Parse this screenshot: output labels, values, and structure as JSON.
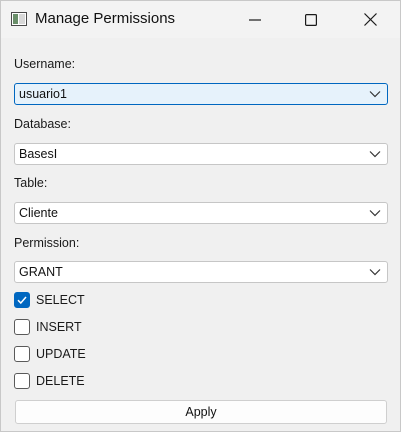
{
  "window": {
    "title": "Manage Permissions"
  },
  "form": {
    "username": {
      "label": "Username:",
      "value": "usuario1"
    },
    "database": {
      "label": "Database:",
      "value": "BasesI"
    },
    "table": {
      "label": "Table:",
      "value": "Cliente"
    },
    "permission": {
      "label": "Permission:",
      "value": "GRANT"
    }
  },
  "privileges": [
    {
      "label": "SELECT",
      "checked": true
    },
    {
      "label": "INSERT",
      "checked": false
    },
    {
      "label": "UPDATE",
      "checked": false
    },
    {
      "label": "DELETE",
      "checked": false
    }
  ],
  "apply_label": "Apply",
  "colors": {
    "accent": "#0067c0",
    "focused_field_bg": "#e6f2fb",
    "window_bg": "#f0f0f0"
  },
  "icons": {
    "app": "app-window-icon",
    "minimize": "minimize-icon",
    "maximize": "maximize-icon",
    "close": "close-icon",
    "dropdown": "chevron-down-icon",
    "check": "checkmark-icon"
  }
}
